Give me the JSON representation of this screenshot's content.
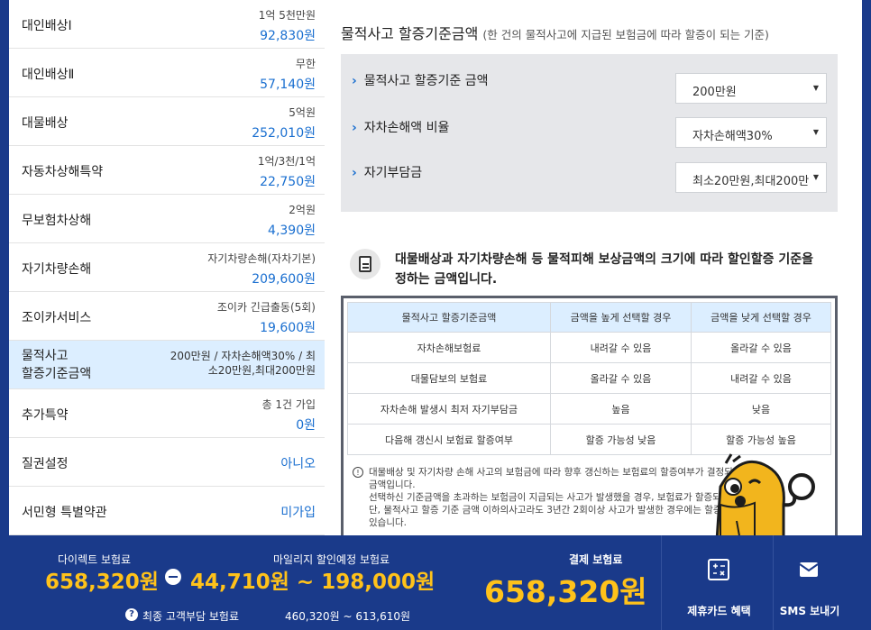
{
  "coverage_items": [
    {
      "label": "대인배상Ⅰ",
      "detail": "1억 5천만원",
      "amount": "92,830원"
    },
    {
      "label": "대인배상Ⅱ",
      "detail": "무한",
      "amount": "57,140원"
    },
    {
      "label": "대물배상",
      "detail": "5억원",
      "amount": "252,010원"
    },
    {
      "label": "자동차상해특약",
      "detail": "1억/3천/1억",
      "amount": "22,750원"
    },
    {
      "label": "무보험차상해",
      "detail": "2억원",
      "amount": "4,390원"
    },
    {
      "label": "자기차량손해",
      "detail": "자기차량손해(자차기본)",
      "amount": "209,600원"
    },
    {
      "label": "조이카서비스",
      "detail": "조이카 긴급출동(5회)",
      "amount": "19,600원"
    },
    {
      "label_line1": "물적사고",
      "label_line2": "할증기준금액",
      "detail_line1": "200만원 / 자차손해액30% / 최",
      "detail_line2": "소20만원,최대200만원"
    },
    {
      "label": "추가특약",
      "detail": "총 1건 가입",
      "amount": "0원"
    },
    {
      "label": "질권설정",
      "amount": "아니오"
    },
    {
      "label": "서민형 특별약관",
      "amount": "미가입"
    }
  ],
  "panel": {
    "title": "물적사고 할증기준금액",
    "title_sub": "(한 건의 물적사고에 지급된 보험금에 따라 할증이 되는 기준)",
    "options": [
      {
        "label": "물적사고 할증기준 금액",
        "value": "200만원"
      },
      {
        "label": "자차손해액 비율",
        "value": "자차손해액30%"
      },
      {
        "label": "자기부담금",
        "value": "최소20만원,최대200만"
      }
    ],
    "info_line1": "대물배상과 자기차량손해 등 물적피해 보상금액의 크기에 따라 할인할증 기준을",
    "info_line2": "정하는 금액입니다.",
    "table": {
      "headers": [
        "물적사고 할증기준금액",
        "금액을 높게 선택할 경우",
        "금액을 낮게 선택할 경우"
      ],
      "rows": [
        [
          "자차손해보험료",
          "내려갈 수 있음",
          "올라갈 수 있음"
        ],
        [
          "대물담보의 보험료",
          "올라갈 수 있음",
          "내려갈 수 있음"
        ],
        [
          "자차손해 발생시 최저 자기부담금",
          "높음",
          "낮음"
        ],
        [
          "다음해 갱신시 보험료 할증여부",
          "할증 가능성 낮음",
          "할증 가능성 높음"
        ]
      ]
    },
    "notes": [
      "대물배상 및 자기차량 손해 사고의 보험금에 따라 향후 갱신하는 보험료의 할증여부가 결정되는 기준",
      "금액입니다.",
      "선택하신 기준금액을 초과하는 보험금이 지급되는 사고가 발생했을 경우, 보험료가 할증되며,",
      "단, 물적사고 할증 기준 금액 이하의사고라도 3년간 2회이상 사고가 발생한 경우에는 할증될 수도",
      "있습니다."
    ]
  },
  "bottom": {
    "direct_label": "다이렉트 보험료",
    "direct_value": "658,320원",
    "mileage_label": "마일리지 할인예정 보험료",
    "mileage_value": "44,710원 ~ 198,000원",
    "final_label": "최종 고객부담 보험료",
    "final_value": "460,320원 ~ 613,610원",
    "pay_label": "결제 보험료",
    "pay_value": "658,320원",
    "card_label": "제휴카드 혜택",
    "sms_label": "SMS 보내기"
  },
  "colors": {
    "brand_navy": "#1a3a8a",
    "accent_blue": "#1a6fd0",
    "highlight_yellow": "#ffc21a",
    "selected_row": "#dceeff"
  },
  "icons": [
    "chevron-right-icon",
    "dropdown-arrow-icon",
    "document-icon",
    "info-circle-icon",
    "minus-circle-icon",
    "question-circle-icon",
    "calculator-icon",
    "envelope-icon",
    "mascot-character"
  ]
}
